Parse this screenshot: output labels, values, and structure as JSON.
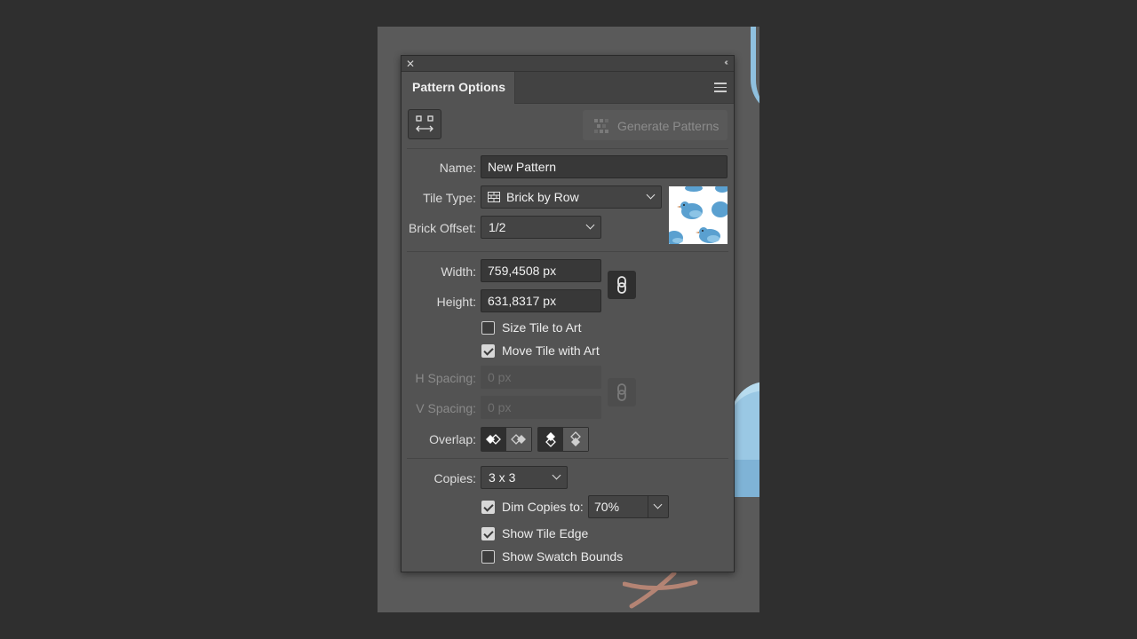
{
  "panel": {
    "tab_title": "Pattern Options",
    "generate_label": "Generate Patterns"
  },
  "fields": {
    "name_label": "Name:",
    "name_value": "New Pattern",
    "tile_type_label": "Tile Type:",
    "tile_type_value": "Brick by Row",
    "brick_offset_label": "Brick Offset:",
    "brick_offset_value": "1/2",
    "width_label": "Width:",
    "width_value": "759,4508 px",
    "height_label": "Height:",
    "height_value": "631,8317 px",
    "h_spacing_label": "H Spacing:",
    "h_spacing_value": "0 px",
    "v_spacing_label": "V Spacing:",
    "v_spacing_value": "0 px",
    "overlap_label": "Overlap:",
    "copies_label": "Copies:",
    "copies_value": "3 x 3",
    "dim_value": "70%"
  },
  "checkboxes": {
    "size_tile": {
      "label": "Size Tile to Art",
      "checked": false
    },
    "move_tile": {
      "label": "Move Tile with Art",
      "checked": true
    },
    "dim_copies": {
      "label": "Dim Copies to:",
      "checked": true
    },
    "show_tile_edge": {
      "label": "Show Tile Edge",
      "checked": true
    },
    "show_swatch_bounds": {
      "label": "Show Swatch Bounds",
      "checked": false
    }
  },
  "icons": {
    "close": "close-icon",
    "collapse": "double-chevron-left-icon",
    "menu": "hamburger-menu-icon",
    "tile_tool": "pattern-tile-tool-icon",
    "tile_type": "brick-tile-icon",
    "link": "chain-link-icon"
  },
  "colors": {
    "panel_bg": "#535353",
    "field_bg": "#383838",
    "bird_blue": "#5aa0d0"
  }
}
